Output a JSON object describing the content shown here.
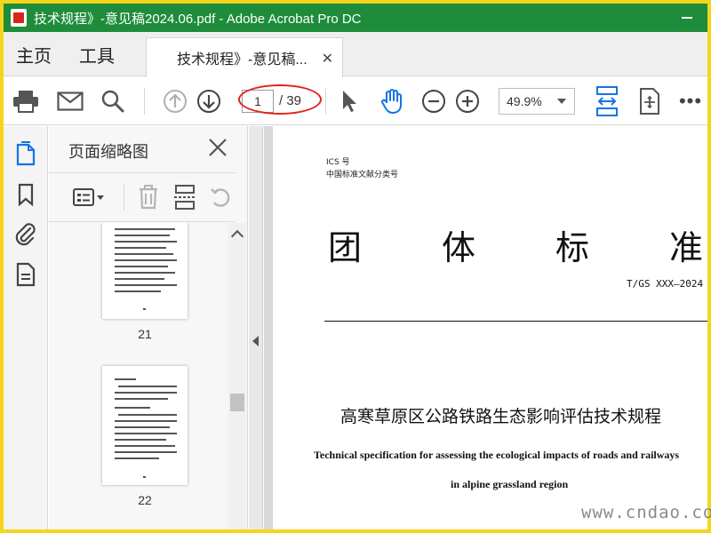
{
  "window": {
    "title": "技术规程》-意见稿2024.06.pdf - Adobe Acrobat Pro DC"
  },
  "tabs": {
    "home": "主页",
    "tools": "工具",
    "document": "技术规程》-意见稿..."
  },
  "toolbar": {
    "current_page": "1",
    "page_total": "/ 39",
    "zoom": "49.9%"
  },
  "thumbnail_panel": {
    "title": "页面缩略图",
    "pages": [
      {
        "number": "21"
      },
      {
        "number": "22"
      }
    ]
  },
  "document": {
    "ics": "ICS 号",
    "classification": "中国标准文献分类号",
    "standard_title": "团体标准",
    "standard_number": "T/GS XXX—2024",
    "title_zh": "高寒草原区公路铁路生态影响评估技术规程",
    "title_en_line1": "Technical specification for assessing the ecological impacts of roads and railways",
    "title_en_line2": "in alpine grassland region"
  },
  "watermark": "www.cndao.com",
  "colors": {
    "titlebar": "#1e8c3a",
    "highlight_ellipse": "#e0231c",
    "accent_blue": "#1473e6",
    "frame_border": "#f5d51c"
  }
}
